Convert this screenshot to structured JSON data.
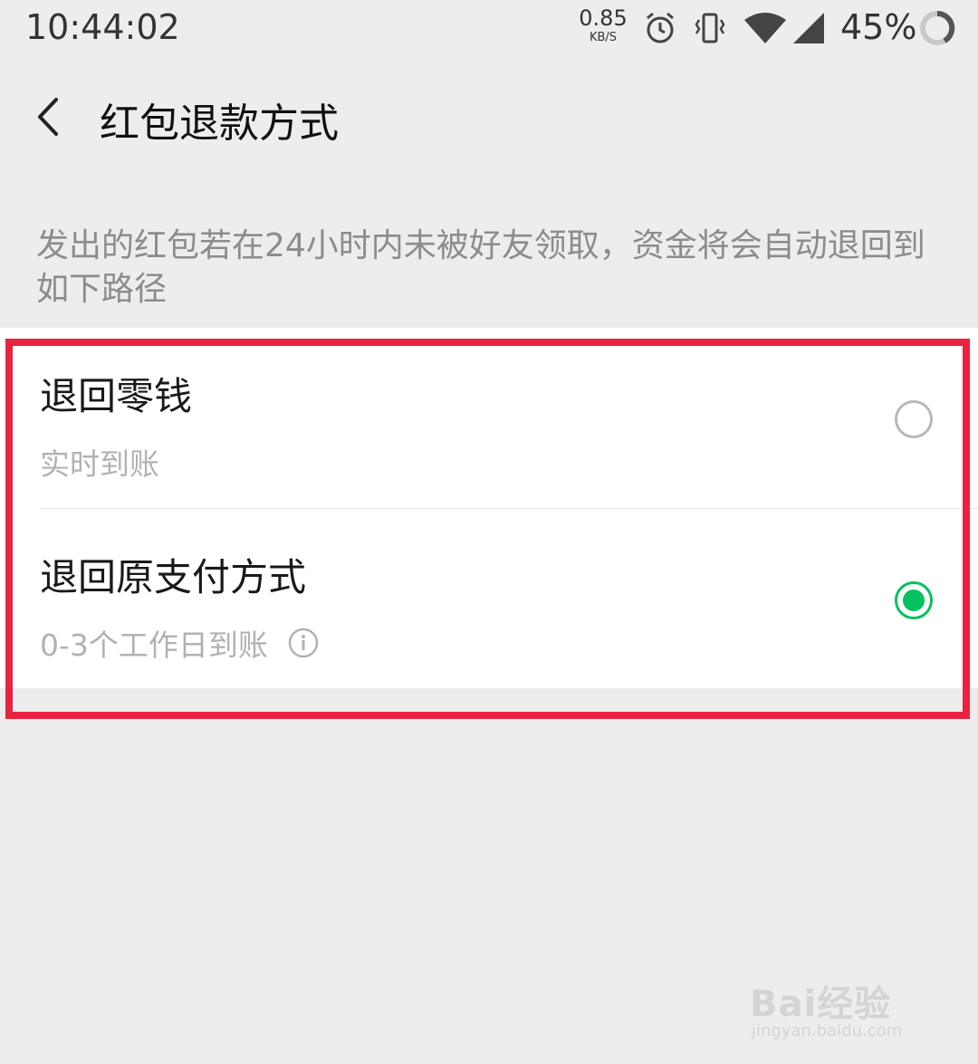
{
  "status_bar": {
    "time": "10:44:02",
    "net_speed_value": "0.85",
    "net_speed_unit": "KB/S",
    "battery_percent": "45%",
    "icons": [
      "alarm-icon",
      "vibrate-icon",
      "wifi-icon",
      "signal-icon",
      "battery-icon"
    ]
  },
  "header": {
    "back_icon": "chevron-left-icon",
    "title": "红包退款方式"
  },
  "description": "发出的红包若在24小时内未被好友领取，资金将会自动退回到如下路径",
  "options": [
    {
      "title": "退回零钱",
      "subtitle": "实时到账",
      "selected": false
    },
    {
      "title": "退回原支付方式",
      "subtitle": "0-3个工作日到账",
      "selected": true,
      "info_icon": "info-icon"
    }
  ],
  "colors": {
    "accent_green": "#07c160",
    "highlight_red": "#e8233f",
    "background": "#ededed"
  },
  "watermark": {
    "logo": "Bai经验",
    "url": "jingyan.baidu.com"
  }
}
